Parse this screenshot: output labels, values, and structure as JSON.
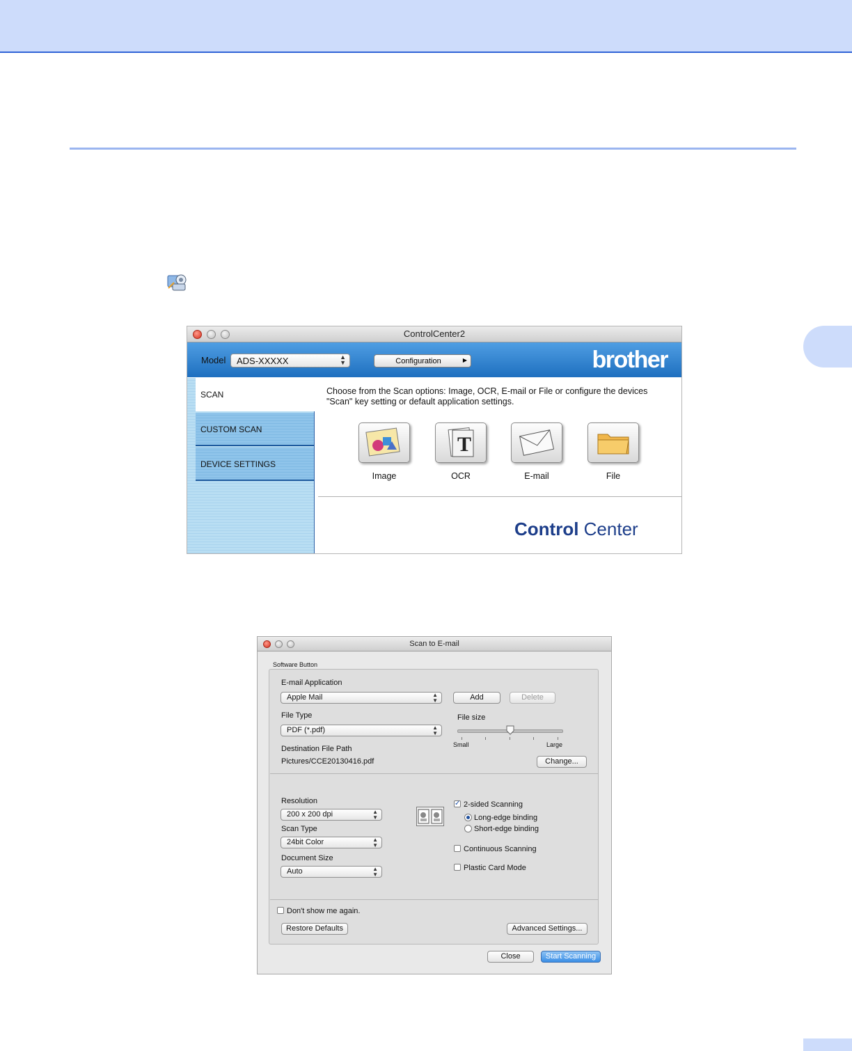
{
  "controlcenter": {
    "window_title": "ControlCenter2",
    "model_label": "Model",
    "model_value": "ADS-XXXXX",
    "configuration_label": "Configuration",
    "brand": "brother",
    "tabs": [
      {
        "label": "SCAN"
      },
      {
        "label": "CUSTOM SCAN"
      },
      {
        "label": "DEVICE SETTINGS"
      }
    ],
    "description_line1": "Choose from the Scan options: Image, OCR, E-mail or File or configure the devices",
    "description_line2": "\"Scan\" key setting or default application settings.",
    "options": [
      {
        "label": "Image",
        "icon": "image-icon"
      },
      {
        "label": "OCR",
        "icon": "ocr-icon"
      },
      {
        "label": "E-mail",
        "icon": "envelope-icon"
      },
      {
        "label": "File",
        "icon": "folder-icon"
      }
    ],
    "logo_part1": "Control",
    "logo_part2": "Center"
  },
  "scan_email": {
    "window_title": "Scan to E-mail",
    "group_label": "Software Button",
    "email_application_label": "E-mail Application",
    "email_application_value": "Apple Mail",
    "add_label": "Add",
    "delete_label": "Delete",
    "file_type_label": "File Type",
    "file_type_value": "PDF (*.pdf)",
    "file_size_label": "File size",
    "file_size_small": "Small",
    "file_size_large": "Large",
    "file_size_level": 0.5,
    "destination_label": "Destination File Path",
    "destination_value": "Pictures/CCE20130416.pdf",
    "change_label": "Change...",
    "resolution_label": "Resolution",
    "resolution_value": "200 x 200 dpi",
    "scan_type_label": "Scan Type",
    "scan_type_value": "24bit Color",
    "document_size_label": "Document Size",
    "document_size_value": "Auto",
    "two_sided_label": "2-sided Scanning",
    "two_sided_checked": true,
    "long_edge_label": "Long-edge binding",
    "short_edge_label": "Short-edge binding",
    "continuous_label": "Continuous Scanning",
    "plastic_card_label": "Plastic Card Mode",
    "dont_show_label": "Don't show me again.",
    "restore_defaults_label": "Restore Defaults",
    "advanced_settings_label": "Advanced Settings...",
    "close_label": "Close",
    "start_scanning_label": "Start Scanning"
  },
  "colors": {
    "page_band": "#cddcfb",
    "band_border": "#2f63d6",
    "cc_header": "#1e6fbf",
    "cc_logo": "#1d3e8a",
    "default_button": "#3a8ee6"
  }
}
